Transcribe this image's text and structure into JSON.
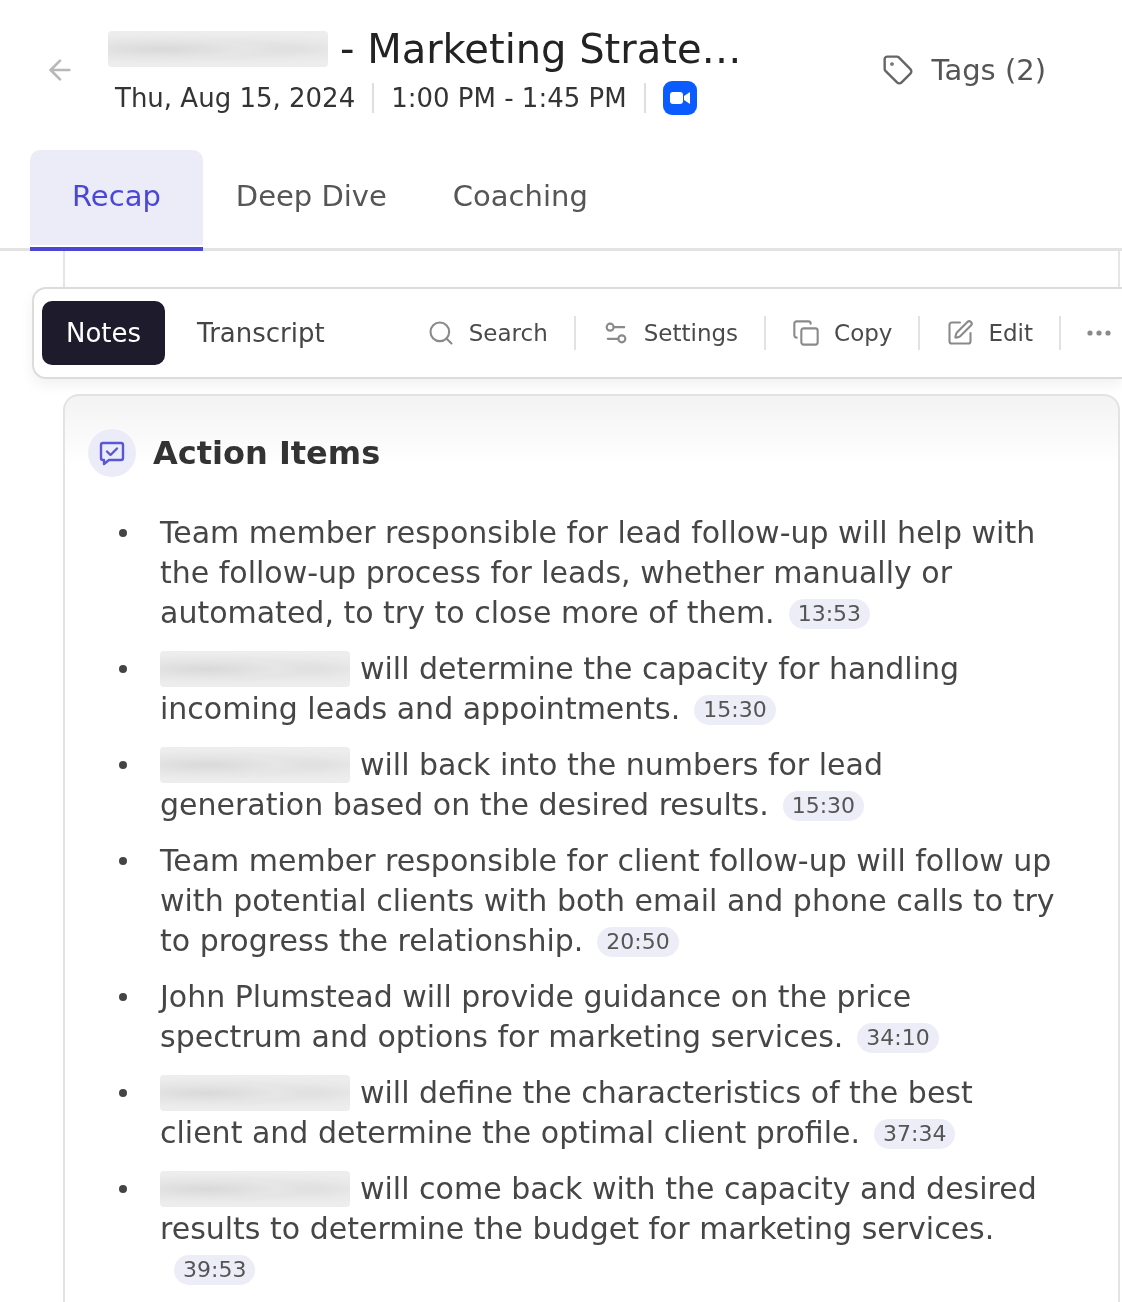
{
  "title": {
    "redacted_prefix": true,
    "text": "- Marketing Strate…"
  },
  "date": "Thu, Aug 15, 2024",
  "time": "1:00 PM - 1:45 PM",
  "tags_button": {
    "label": "Tags (2)"
  },
  "tabs": [
    {
      "label": "Recap",
      "selected": true
    },
    {
      "label": "Deep Dive",
      "selected": false
    },
    {
      "label": "Coaching",
      "selected": false
    }
  ],
  "note_modes": [
    {
      "label": "Notes",
      "selected": true
    },
    {
      "label": "Transcript",
      "selected": false
    }
  ],
  "toolbar": [
    {
      "kind": "search",
      "label": "Search"
    },
    {
      "kind": "settings",
      "label": "Settings"
    },
    {
      "kind": "copy",
      "label": "Copy"
    },
    {
      "kind": "edit",
      "label": "Edit"
    },
    {
      "kind": "more"
    }
  ],
  "section": {
    "title": "Action Items",
    "items": [
      {
        "redacted_name": false,
        "text": "Team member responsible for lead follow-up will help with the follow-up process for leads, whether manually or automated, to try to close more of them.",
        "timestamp": "13:53"
      },
      {
        "redacted_name": true,
        "text": "will determine the capacity for handling incoming leads and appointments.",
        "timestamp": "15:30"
      },
      {
        "redacted_name": true,
        "text": "will back into the numbers for lead generation based on the desired results.",
        "timestamp": "15:30"
      },
      {
        "redacted_name": false,
        "text": "Team member responsible for client follow-up will follow up with potential clients with both email and phone calls to try to progress the relationship.",
        "timestamp": "20:50"
      },
      {
        "redacted_name": false,
        "text": "John Plumstead will provide guidance on the price spectrum and options for marketing services.",
        "timestamp": "34:10"
      },
      {
        "redacted_name": true,
        "text": "will define the characteristics of the best client and determine the optimal client profile.",
        "timestamp": "37:34"
      },
      {
        "redacted_name": true,
        "text": "will come back with the capacity and desired results to determine the budget for marketing services.",
        "timestamp": "39:53"
      }
    ]
  }
}
